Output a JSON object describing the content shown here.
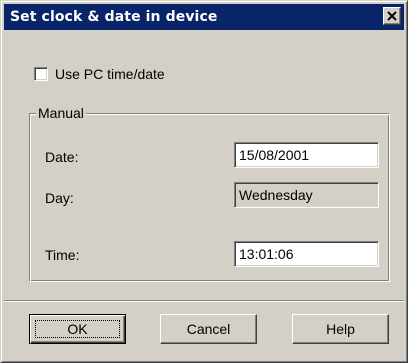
{
  "window": {
    "title": "Set clock & date in device",
    "close_icon": "close-icon"
  },
  "use_pc_time": {
    "label": "Use PC time/date",
    "checked": false
  },
  "manual": {
    "legend": "Manual",
    "date_label": "Date:",
    "date_value": "15/08/2001",
    "day_label": "Day:",
    "day_value": "Wednesday",
    "time_label": "Time:",
    "time_value": "13:01:06"
  },
  "buttons": {
    "ok": "OK",
    "cancel": "Cancel",
    "help": "Help"
  },
  "colors": {
    "title_bar": "#0a246a",
    "face": "#d4d0c8"
  }
}
